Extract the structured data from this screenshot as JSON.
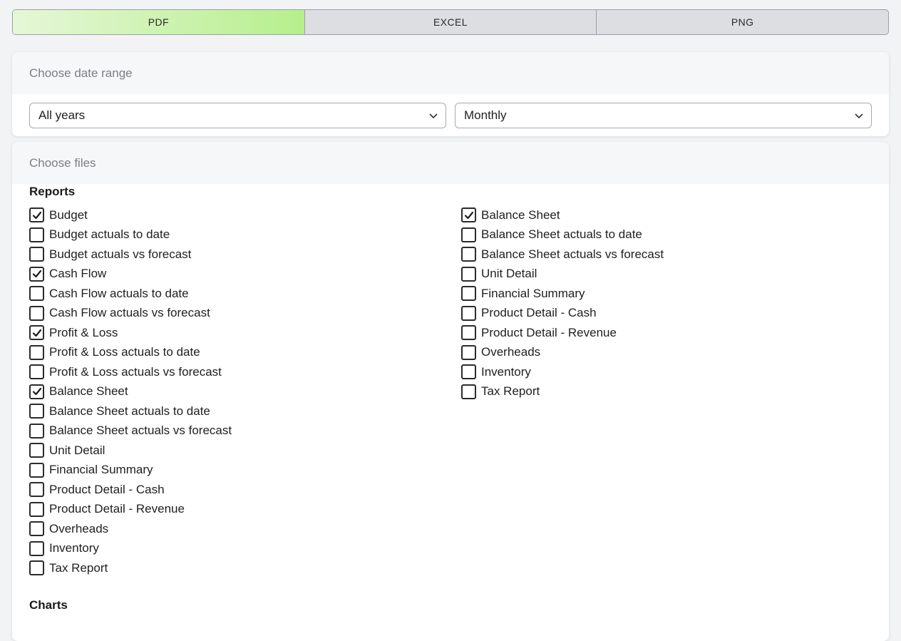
{
  "tabs": [
    {
      "label": "PDF",
      "active": true
    },
    {
      "label": "EXCEL",
      "active": false
    },
    {
      "label": "PNG",
      "active": false
    }
  ],
  "date_range": {
    "header": "Choose date range",
    "year_select": "All years",
    "period_select": "Monthly"
  },
  "files": {
    "header": "Choose files",
    "reports_title": "Reports",
    "left_items": [
      {
        "label": "Budget",
        "checked": true
      },
      {
        "label": "Budget actuals to date",
        "checked": false
      },
      {
        "label": "Budget actuals vs forecast",
        "checked": false
      },
      {
        "label": "Cash Flow",
        "checked": true
      },
      {
        "label": "Cash Flow actuals to date",
        "checked": false
      },
      {
        "label": "Cash Flow actuals vs forecast",
        "checked": false
      },
      {
        "label": "Profit & Loss",
        "checked": true
      },
      {
        "label": "Profit & Loss actuals to date",
        "checked": false
      },
      {
        "label": "Profit & Loss actuals vs forecast",
        "checked": false
      },
      {
        "label": "Balance Sheet",
        "checked": true
      },
      {
        "label": "Balance Sheet actuals to date",
        "checked": false
      },
      {
        "label": "Balance Sheet actuals vs forecast",
        "checked": false
      },
      {
        "label": "Unit Detail",
        "checked": false
      },
      {
        "label": "Financial Summary",
        "checked": false
      },
      {
        "label": "Product Detail - Cash",
        "checked": false
      },
      {
        "label": "Product Detail - Revenue",
        "checked": false
      },
      {
        "label": "Overheads",
        "checked": false
      },
      {
        "label": "Inventory",
        "checked": false
      },
      {
        "label": "Tax Report",
        "checked": false
      }
    ],
    "right_items": [
      {
        "label": "Balance Sheet",
        "checked": true
      },
      {
        "label": "Balance Sheet actuals to date",
        "checked": false
      },
      {
        "label": "Balance Sheet actuals vs forecast",
        "checked": false
      },
      {
        "label": "Unit Detail",
        "checked": false
      },
      {
        "label": "Financial Summary",
        "checked": false
      },
      {
        "label": "Product Detail - Cash",
        "checked": false
      },
      {
        "label": "Product Detail - Revenue",
        "checked": false
      },
      {
        "label": "Overheads",
        "checked": false
      },
      {
        "label": "Inventory",
        "checked": false
      },
      {
        "label": "Tax Report",
        "checked": false
      }
    ],
    "charts_title": "Charts"
  }
}
